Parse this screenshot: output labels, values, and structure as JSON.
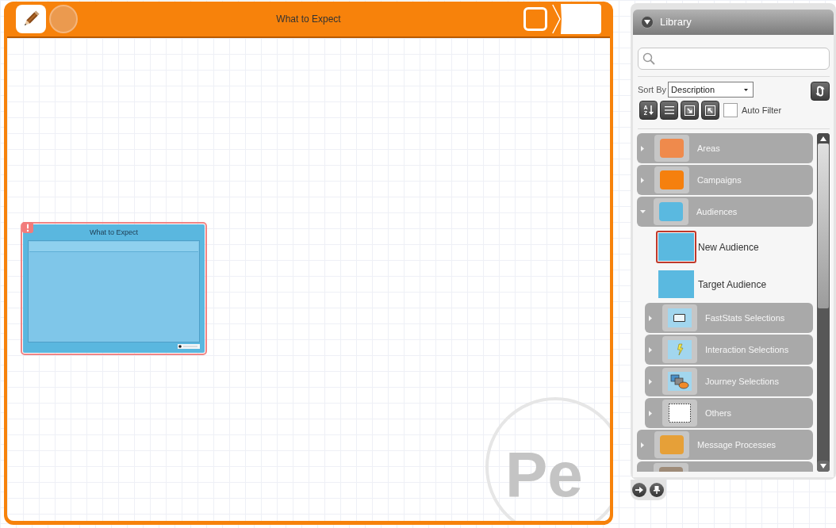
{
  "canvas": {
    "title": "What to Expect",
    "tools": [
      {
        "kind": "pencil",
        "disabled": false
      },
      {
        "kind": "circle",
        "disabled": true
      }
    ],
    "watermark": "Pe",
    "nodes": [
      {
        "title": "What to Expect",
        "warning": true
      }
    ]
  },
  "library": {
    "title": "Library",
    "expanded": true,
    "sort": {
      "label": "Sort By",
      "value": "Description"
    },
    "tools": [
      {
        "kind": "sort",
        "upper_letter": "A",
        "lower_letter": "Z"
      },
      {
        "kind": "list"
      },
      {
        "kind": "expand"
      },
      {
        "kind": "collapse"
      }
    ],
    "auto_filter": {
      "label": "Auto Filter",
      "checked": false
    },
    "tree": [
      {
        "kind": "swatch",
        "label": "Areas",
        "color": "#ef8a4c",
        "expanded": false
      },
      {
        "kind": "swatch",
        "label": "Campaigns",
        "color": "#f5800e",
        "expanded": false
      },
      {
        "kind": "swatch",
        "label": "Audiences",
        "color": "#5ab9e0",
        "expanded": true,
        "children": [
          {
            "kind": "item",
            "label": "New Audience",
            "selected": true
          },
          {
            "kind": "item",
            "label": "Target Audience",
            "selected": false
          },
          {
            "kind": "card",
            "label": "FastStats Selections",
            "expanded": false
          },
          {
            "kind": "bolt",
            "label": "Interaction Selections",
            "expanded": false
          },
          {
            "kind": "shapes",
            "label": "Journey Selections",
            "expanded": false
          },
          {
            "kind": "blank",
            "label": "Others",
            "expanded": false
          }
        ]
      },
      {
        "kind": "swatch",
        "label": "Message Processes",
        "color": "#e6a038",
        "expanded": false
      },
      {
        "kind": "swatch",
        "color": "#9e8b78"
      }
    ]
  }
}
